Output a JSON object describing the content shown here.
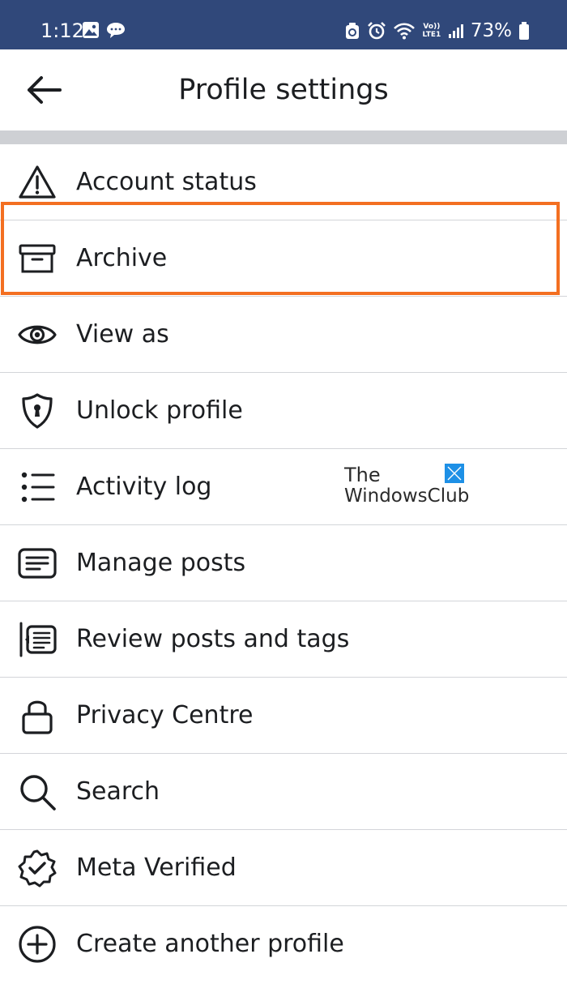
{
  "status_bar": {
    "time": "1:12",
    "network_label": "Vo)) LTE1",
    "battery_percent": "73%",
    "background": "#30487a"
  },
  "header": {
    "title": "Profile settings",
    "back_icon": "arrow-left-icon"
  },
  "menu": {
    "items": [
      {
        "label": "Account status",
        "icon": "warning-triangle-icon"
      },
      {
        "label": "Archive",
        "icon": "archive-box-icon",
        "highlighted": true
      },
      {
        "label": "View as",
        "icon": "eye-icon"
      },
      {
        "label": "Unlock profile",
        "icon": "shield-keyhole-icon"
      },
      {
        "label": "Activity log",
        "icon": "list-icon"
      },
      {
        "label": "Manage posts",
        "icon": "posts-icon"
      },
      {
        "label": "Review posts and tags",
        "icon": "review-tags-icon"
      },
      {
        "label": "Privacy Centre",
        "icon": "lock-icon"
      },
      {
        "label": "Search",
        "icon": "search-icon"
      },
      {
        "label": "Meta Verified",
        "icon": "verified-badge-icon"
      },
      {
        "label": "Create another profile",
        "icon": "add-circle-icon"
      }
    ]
  },
  "highlight_color": "#f36f21",
  "watermark": {
    "line1": "The",
    "line2": "WindowsClub",
    "logo_color": "#1e90e6"
  }
}
